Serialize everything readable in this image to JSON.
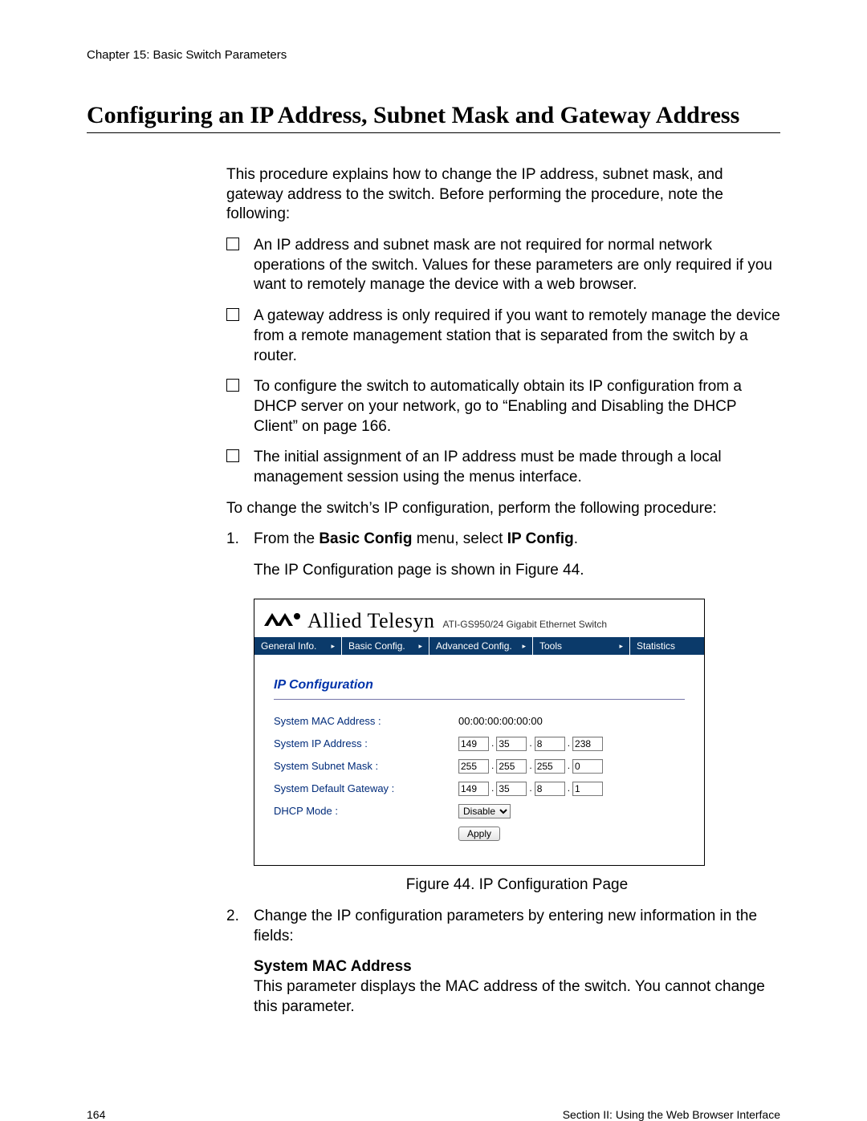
{
  "header": {
    "chapter": "Chapter 15: Basic Switch Parameters"
  },
  "title": "Configuring an IP Address, Subnet Mask and Gateway Address",
  "intro": "This procedure explains how to change the IP address, subnet mask, and gateway address to the switch. Before performing the procedure, note the following:",
  "bullets": [
    "An IP address and subnet mask are not required for normal network operations of the switch. Values for these parameters are only required if you want to remotely manage the device with a web browser.",
    "A gateway address is only required if you want to remotely manage the device from a remote management station that is separated from the switch by a router.",
    "To configure the switch to automatically obtain its IP configuration from a DHCP server on your network, go to “Enabling and Disabling the DHCP Client” on page 166.",
    "The initial assignment of an IP address must be made through a local management session using the menus interface."
  ],
  "lead_in": "To change the switch’s IP configuration, perform the following procedure:",
  "step1": {
    "num": "1.",
    "prefix": "From the ",
    "bold1": "Basic Config",
    "mid": " menu, select ",
    "bold2": "IP Config",
    "suffix": ".",
    "desc": "The IP Configuration page is shown in Figure 44."
  },
  "figure": {
    "brand": "Allied Telesyn",
    "model": "ATI-GS950/24 Gigabit Ethernet Switch",
    "nav": [
      "General Info.",
      "Basic Config.",
      "Advanced Config.",
      "Tools",
      "Statistics"
    ],
    "section_title": "IP Configuration",
    "rows": {
      "mac": {
        "label": "System MAC Address :",
        "value": "00:00:00:00:00:00"
      },
      "ip": {
        "label": "System IP Address :",
        "octets": [
          "149",
          "35",
          "8",
          "238"
        ]
      },
      "mask": {
        "label": "System Subnet Mask :",
        "octets": [
          "255",
          "255",
          "255",
          "0"
        ]
      },
      "gw": {
        "label": "System Default Gateway :",
        "octets": [
          "149",
          "35",
          "8",
          "1"
        ]
      },
      "dhcp": {
        "label": "DHCP Mode :",
        "value": "Disable"
      }
    },
    "apply": "Apply",
    "caption": "Figure 44. IP Configuration Page"
  },
  "step2": {
    "num": "2.",
    "text": "Change the IP configuration parameters by entering new information in the fields:",
    "param_title": "System MAC Address",
    "param_desc": "This parameter displays the MAC address of the switch. You cannot change this parameter."
  },
  "footer": {
    "page": "164",
    "section": "Section II: Using the Web Browser Interface"
  }
}
